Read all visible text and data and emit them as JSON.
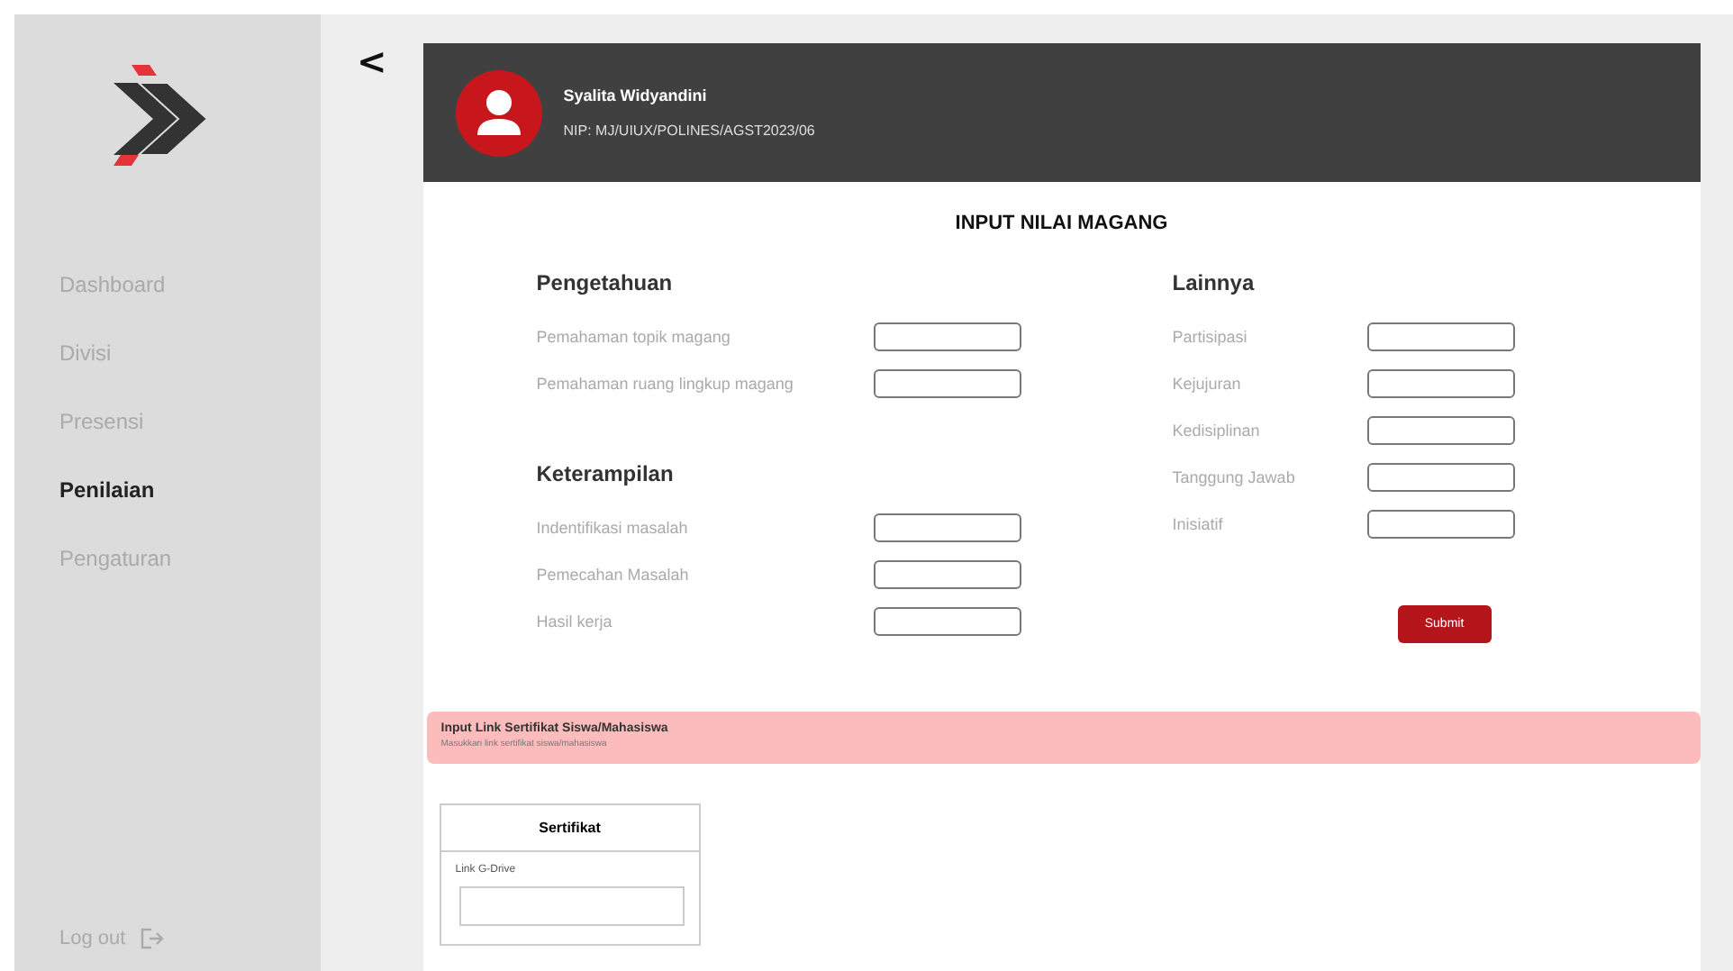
{
  "sidebar": {
    "items": [
      {
        "label": "Dashboard",
        "selected": false
      },
      {
        "label": "Divisi",
        "selected": false
      },
      {
        "label": "Presensi",
        "selected": false
      },
      {
        "label": "Penilaian",
        "selected": true
      },
      {
        "label": "Pengaturan",
        "selected": false
      }
    ],
    "logout": "Log out"
  },
  "back": "<",
  "profile": {
    "name": "Syalita Widyandini",
    "nip": "NIP: MJ/UIUX/POLINES/AGST2023/06"
  },
  "title": "INPUT NILAI MAGANG",
  "left_sections": [
    {
      "heading": "Pengetahuan",
      "fields": [
        "Pemahaman topik magang",
        "Pemahaman ruang lingkup magang"
      ]
    },
    {
      "heading": "Keterampilan",
      "fields": [
        "Indentifikasi masalah",
        "Pemecahan Masalah",
        "Hasil kerja"
      ]
    }
  ],
  "right_section": {
    "heading": "Lainnya",
    "fields": [
      "Partisipasi",
      "Kejujuran",
      "Kedisiplinan",
      "Tanggung Jawab",
      "Inisiatif"
    ]
  },
  "submit": "Submit",
  "banner": {
    "title": "Input Link Sertifikat Siswa/Mahasiswa",
    "subtitle": "Masukkan link sertifikat siswa/mahasiswa"
  },
  "certificate": {
    "title": "Sertifikat",
    "label": "Link G-Drive"
  }
}
